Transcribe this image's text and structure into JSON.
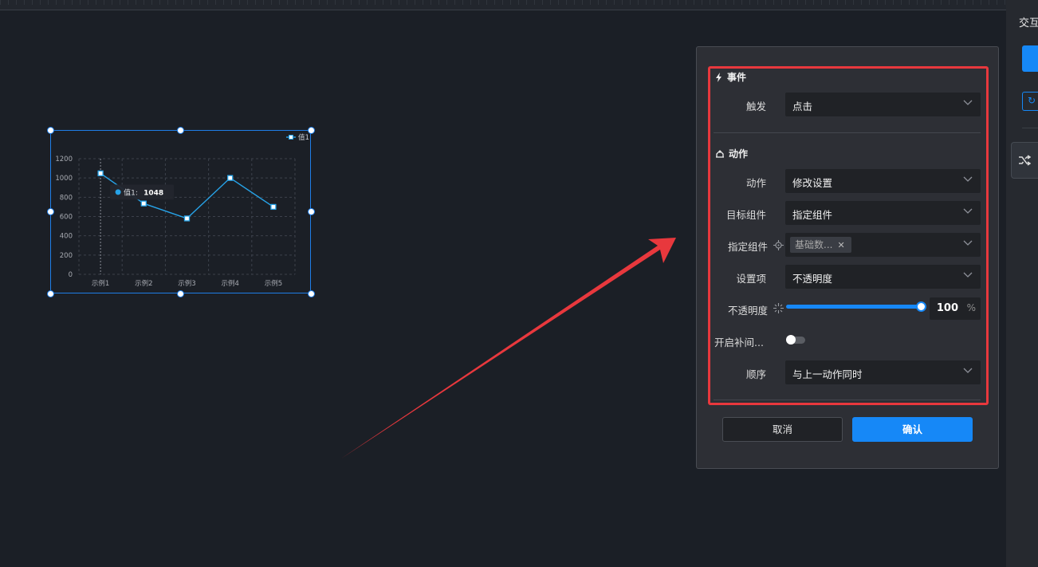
{
  "right_panel": {
    "tab_label": "交互"
  },
  "chart_data": {
    "type": "line",
    "categories": [
      "示例1",
      "示例2",
      "示例3",
      "示例4",
      "示例5"
    ],
    "series": [
      {
        "name": "值1",
        "values": [
          1048,
          735,
          580,
          1000,
          700
        ],
        "color": "#27a3e8"
      }
    ],
    "y_ticks": [
      "1200",
      "1000",
      "800",
      "600",
      "400",
      "200",
      "0"
    ],
    "ylim": [
      0,
      1200
    ],
    "grid": true,
    "legend": "top-right",
    "tooltip": {
      "label": "值1:",
      "value": "1048"
    }
  },
  "dialog": {
    "event_section": {
      "title": "事件",
      "trigger": {
        "label": "触发",
        "value": "点击"
      }
    },
    "action_section": {
      "title": "动作",
      "action": {
        "label": "动作",
        "value": "修改设置"
      },
      "target": {
        "label": "目标组件",
        "value": "指定组件"
      },
      "specified": {
        "label": "指定组件",
        "tag": "基础数..."
      },
      "setting": {
        "label": "设置项",
        "value": "不透明度"
      },
      "opacity": {
        "label": "不透明度",
        "value": "100",
        "unit": "%",
        "level": 1.0
      },
      "tween": {
        "label": "开启补间...",
        "enabled": false
      },
      "order": {
        "label": "顺序",
        "value": "与上一动作同时"
      }
    },
    "cancel_label": "取消",
    "confirm_label": "确认"
  },
  "colors": {
    "accent": "#1688f7",
    "highlight_box": "#e8383d",
    "line": "#27a3e8"
  },
  "icons": [
    "lightning-icon",
    "action-icon",
    "chevron-down-icon",
    "target-icon",
    "sparkle-icon",
    "shuffle-icon",
    "rotate-icon"
  ]
}
